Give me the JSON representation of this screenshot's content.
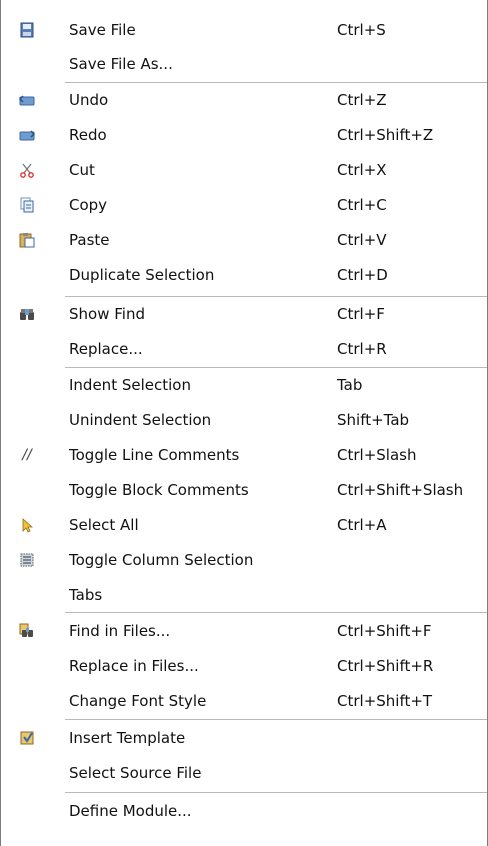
{
  "menu": {
    "items": [
      {
        "label": "Save File",
        "shortcut": "Ctrl+S",
        "icon": "save-file-icon"
      },
      {
        "label": "Save File As...",
        "shortcut": "",
        "icon": ""
      },
      {
        "label": "Undo",
        "shortcut": "Ctrl+Z",
        "icon": "undo-icon"
      },
      {
        "label": "Redo",
        "shortcut": "Ctrl+Shift+Z",
        "icon": "redo-icon"
      },
      {
        "label": "Cut",
        "shortcut": "Ctrl+X",
        "icon": "scissors-icon"
      },
      {
        "label": "Copy",
        "shortcut": "Ctrl+C",
        "icon": "copy-icon"
      },
      {
        "label": "Paste",
        "shortcut": "Ctrl+V",
        "icon": "paste-icon"
      },
      {
        "label": "Duplicate Selection",
        "shortcut": "Ctrl+D",
        "icon": ""
      },
      {
        "label": "Show Find",
        "shortcut": "Ctrl+F",
        "icon": "binoculars-icon"
      },
      {
        "label": "Replace...",
        "shortcut": "Ctrl+R",
        "icon": ""
      },
      {
        "label": "Indent Selection",
        "shortcut": "Tab",
        "icon": ""
      },
      {
        "label": "Unindent Selection",
        "shortcut": "Shift+Tab",
        "icon": ""
      },
      {
        "label": "Toggle Line Comments",
        "shortcut": "Ctrl+Slash",
        "icon": "line-comment-icon",
        "icon_glyph": "//"
      },
      {
        "label": "Toggle Block Comments",
        "shortcut": "Ctrl+Shift+Slash",
        "icon": ""
      },
      {
        "label": "Select All",
        "shortcut": "Ctrl+A",
        "icon": "cursor-arrow-icon"
      },
      {
        "label": "Toggle Column Selection",
        "shortcut": "",
        "icon": "column-selection-icon"
      },
      {
        "label": "Tabs",
        "shortcut": "",
        "icon": ""
      },
      {
        "label": "Find in Files...",
        "shortcut": "Ctrl+Shift+F",
        "icon": "find-in-files-icon"
      },
      {
        "label": "Replace in Files...",
        "shortcut": "Ctrl+Shift+R",
        "icon": ""
      },
      {
        "label": "Change Font Style",
        "shortcut": "Ctrl+Shift+T",
        "icon": ""
      },
      {
        "label": "Insert Template",
        "shortcut": "",
        "icon": "insert-template-icon"
      },
      {
        "label": "Select Source File",
        "shortcut": "",
        "icon": ""
      },
      {
        "label": "Define Module...",
        "shortcut": "",
        "icon": ""
      }
    ]
  }
}
